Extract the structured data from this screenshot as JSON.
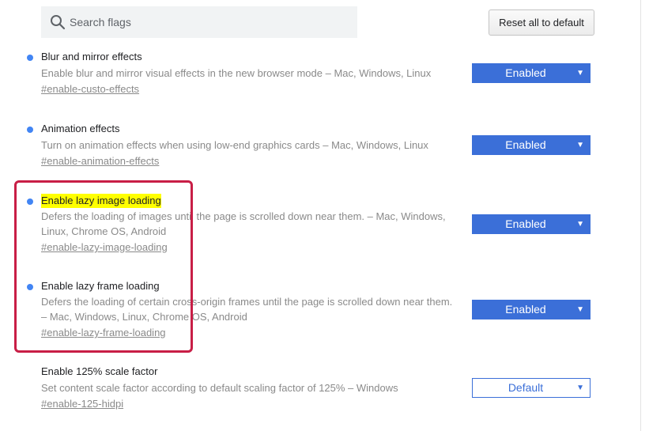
{
  "search": {
    "placeholder": "Search flags",
    "icon": "search-icon"
  },
  "reset_button": {
    "label": "Reset all to default"
  },
  "accent_color": "#3b6fd8",
  "flags": [
    {
      "title": "Blur and mirror effects",
      "description": "Enable blur and mirror visual effects in the new browser mode – Mac, Windows, Linux",
      "link": "#enable-custo-effects",
      "value": "Enabled",
      "modified": true,
      "highlighted": false
    },
    {
      "title": "Animation effects",
      "description": "Turn on animation effects when using low-end graphics cards – Mac, Windows, Linux",
      "link": "#enable-animation-effects",
      "value": "Enabled",
      "modified": true,
      "highlighted": false
    },
    {
      "title": "Enable lazy image loading",
      "description": "Defers the loading of images until the page is scrolled down near them. – Mac, Windows, Linux, Chrome OS, Android",
      "link": "#enable-lazy-image-loading",
      "value": "Enabled",
      "modified": true,
      "highlighted": true
    },
    {
      "title": "Enable lazy frame loading",
      "description": "Defers the loading of certain cross-origin frames until the page is scrolled down near them. – Mac, Windows, Linux, Chrome OS, Android",
      "link": "#enable-lazy-frame-loading",
      "value": "Enabled",
      "modified": true,
      "highlighted": false
    },
    {
      "title": "Enable 125% scale factor",
      "description": "Set content scale factor according to default scaling factor of 125% – Windows",
      "link": "#enable-125-hidpi",
      "value": "Default",
      "modified": false,
      "highlighted": false
    }
  ]
}
